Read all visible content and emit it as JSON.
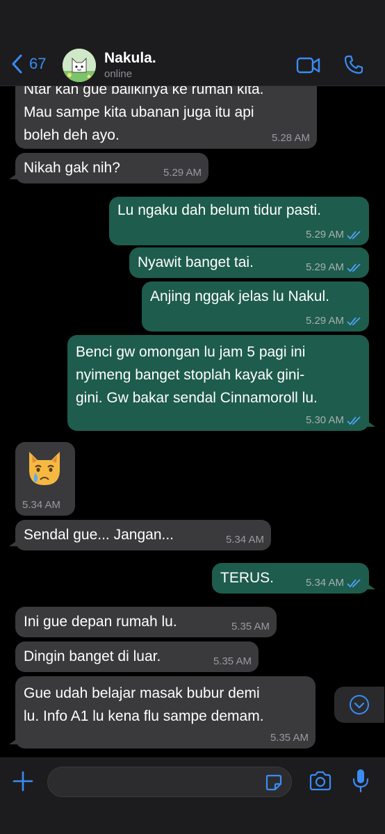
{
  "header": {
    "back_count": "67",
    "contact_name": "Nakula.",
    "status": "online"
  },
  "messages": [
    {
      "dir": "in",
      "text": "Ntar kan gue balikinya ke rumah kita.\nMau sampe kita ubanan juga itu api\nboleh deh ayo.",
      "time": "5.28 AM"
    },
    {
      "dir": "in",
      "text": "Nikah gak nih?",
      "time": "5.29 AM"
    },
    {
      "dir": "out",
      "text": "Lu ngaku dah belum tidur pasti.",
      "time": "5.29 AM"
    },
    {
      "dir": "out",
      "text": "Nyawit banget tai.",
      "time": "5.29 AM"
    },
    {
      "dir": "out",
      "text": "Anjing nggak jelas lu Nakul.",
      "time": "5.29 AM"
    },
    {
      "dir": "out",
      "text": "Benci gw omongan lu jam 5 pagi ini\nnyimeng banget stoplah kayak gini-\ngini. Gw bakar sendal Cinnamoroll lu.",
      "time": "5.30 AM"
    },
    {
      "dir": "in",
      "emoji": "crying-cat-face",
      "time": "5.34 AM"
    },
    {
      "dir": "in",
      "text": "Sendal gue... Jangan...",
      "time": "5.34 AM"
    },
    {
      "dir": "out",
      "text": "TERUS.",
      "time": "5.34 AM"
    },
    {
      "dir": "in",
      "text": "Ini gue depan rumah lu.",
      "time": "5.35 AM"
    },
    {
      "dir": "in",
      "text": "Dingin banget di luar.",
      "time": "5.35 AM"
    },
    {
      "dir": "in",
      "text": "Gue udah belajar masak bubur demi\nlu. Info A1 lu kena flu sampe demam.",
      "time": "5.35 AM"
    }
  ],
  "input": {
    "placeholder": "",
    "value": ""
  },
  "colors": {
    "accent": "#3b8cf5",
    "outgoing": "#1e5c4d",
    "incoming": "#3a3a3c",
    "read_check": "#4fa3f7"
  },
  "icons": [
    "back-chevron-icon",
    "video-call-icon",
    "phone-icon",
    "plus-icon",
    "sticker-icon",
    "camera-icon",
    "microphone-icon",
    "scroll-down-icon",
    "double-check-icon"
  ]
}
